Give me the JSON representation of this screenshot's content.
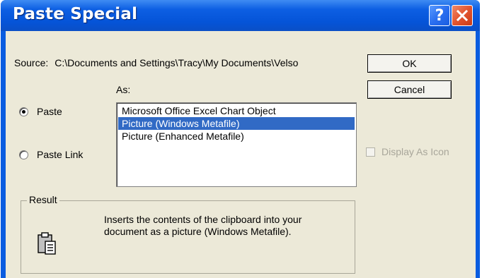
{
  "window": {
    "title": "Paste Special",
    "help_glyph": "?",
    "colors": {
      "titlebar": "#0554d8",
      "client": "#ece9d8",
      "selection": "#316ac5"
    }
  },
  "source": {
    "label": "Source:",
    "path": "C:\\Documents and Settings\\Tracy\\My Documents\\Velso"
  },
  "buttons": {
    "ok": "OK",
    "cancel": "Cancel"
  },
  "as_label": "As:",
  "radios": [
    {
      "label": "Paste",
      "checked": true
    },
    {
      "label": "Paste Link",
      "checked": false
    }
  ],
  "list": {
    "items": [
      {
        "label": "Microsoft Office Excel Chart Object",
        "selected": false
      },
      {
        "label": "Picture (Windows Metafile)",
        "selected": true
      },
      {
        "label": "Picture (Enhanced Metafile)",
        "selected": false
      }
    ]
  },
  "display_as_icon": {
    "label": "Display As Icon",
    "checked": false,
    "enabled": false
  },
  "result": {
    "legend": "Result",
    "line1": "Inserts the contents of the clipboard into your",
    "line2": "document as a picture (Windows Metafile).",
    "icon": "clipboard-icon"
  }
}
